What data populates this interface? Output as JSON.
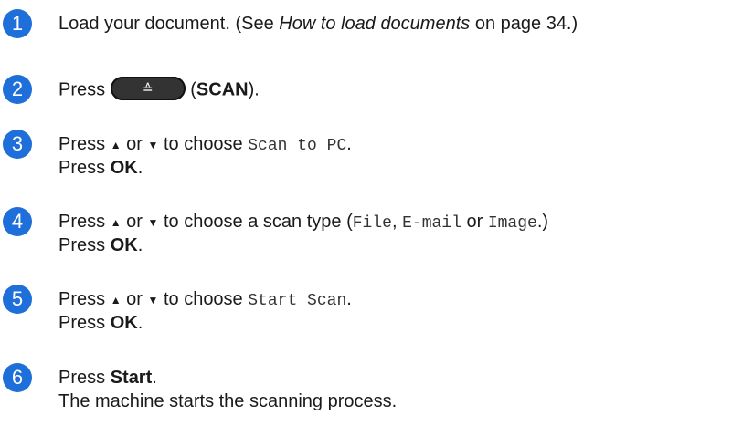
{
  "accent_color": "#1e6fd9",
  "up_arrow": "▲",
  "down_arrow": "▼",
  "scan_key_icon": "scanner-icon",
  "steps": [
    {
      "number": "1",
      "lines": [
        {
          "a": "Load your document. (See ",
          "ref": "How to load documents",
          "b": " on page 34.)"
        }
      ]
    },
    {
      "number": "2",
      "press": "Press",
      "button_label": "SCAN"
    },
    {
      "number": "3",
      "press": "Press",
      "or": "or",
      "to_choose": "to choose",
      "option": "Scan to PC",
      "line2_press": "Press",
      "line2_key": "OK"
    },
    {
      "number": "4",
      "press": "Press",
      "or": "or",
      "to_choose": "to choose a scan type (",
      "types": [
        "File",
        "E-mail",
        "Image"
      ],
      "types_sep": ", ",
      "types_or": " or ",
      "types_end": ".)",
      "line2_press": "Press",
      "line2_key": "OK"
    },
    {
      "number": "5",
      "press": "Press",
      "or": "or",
      "to_choose": "to choose",
      "option": "Start Scan",
      "line2_press": "Press",
      "line2_key": "OK"
    },
    {
      "number": "6",
      "press": "Press",
      "key": "Start",
      "line2": "The machine starts the scanning process."
    }
  ]
}
